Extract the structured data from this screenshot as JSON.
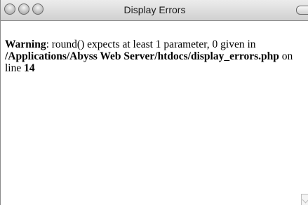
{
  "window": {
    "title": "Display Errors"
  },
  "error": {
    "label": "Warning",
    "message": ": round() expects at least 1 parameter, 0 given in ",
    "path": "/Applications/Abyss Web Server/htdocs/display_errors.php",
    "on_line": " on line ",
    "line_number": "14"
  }
}
